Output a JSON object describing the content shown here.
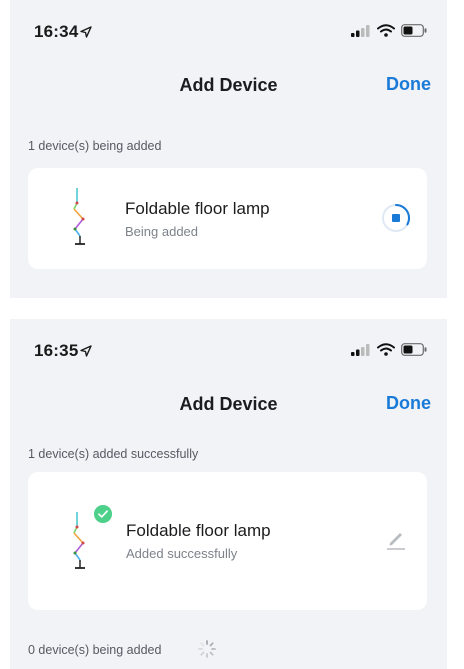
{
  "screens": [
    {
      "time": "16:34",
      "title": "Add Device",
      "done_label": "Done",
      "section_label": "1 device(s) being added",
      "device": {
        "name": "Foldable floor lamp",
        "status": "Being added"
      }
    },
    {
      "time": "16:35",
      "title": "Add Device",
      "done_label": "Done",
      "section_label": "1 device(s) added successfully",
      "device": {
        "name": "Foldable floor lamp",
        "status": "Added successfully"
      },
      "footer_label": "0 device(s) being added"
    }
  ],
  "colors": {
    "accent": "#1a7ad8",
    "success": "#4cd08a",
    "background": "#f2f3f7"
  },
  "icons": [
    "location-arrow-icon",
    "cellular-icon",
    "wifi-icon",
    "battery-icon",
    "lamp-icon",
    "progress-icon",
    "check-icon",
    "edit-icon",
    "spinner-icon"
  ]
}
